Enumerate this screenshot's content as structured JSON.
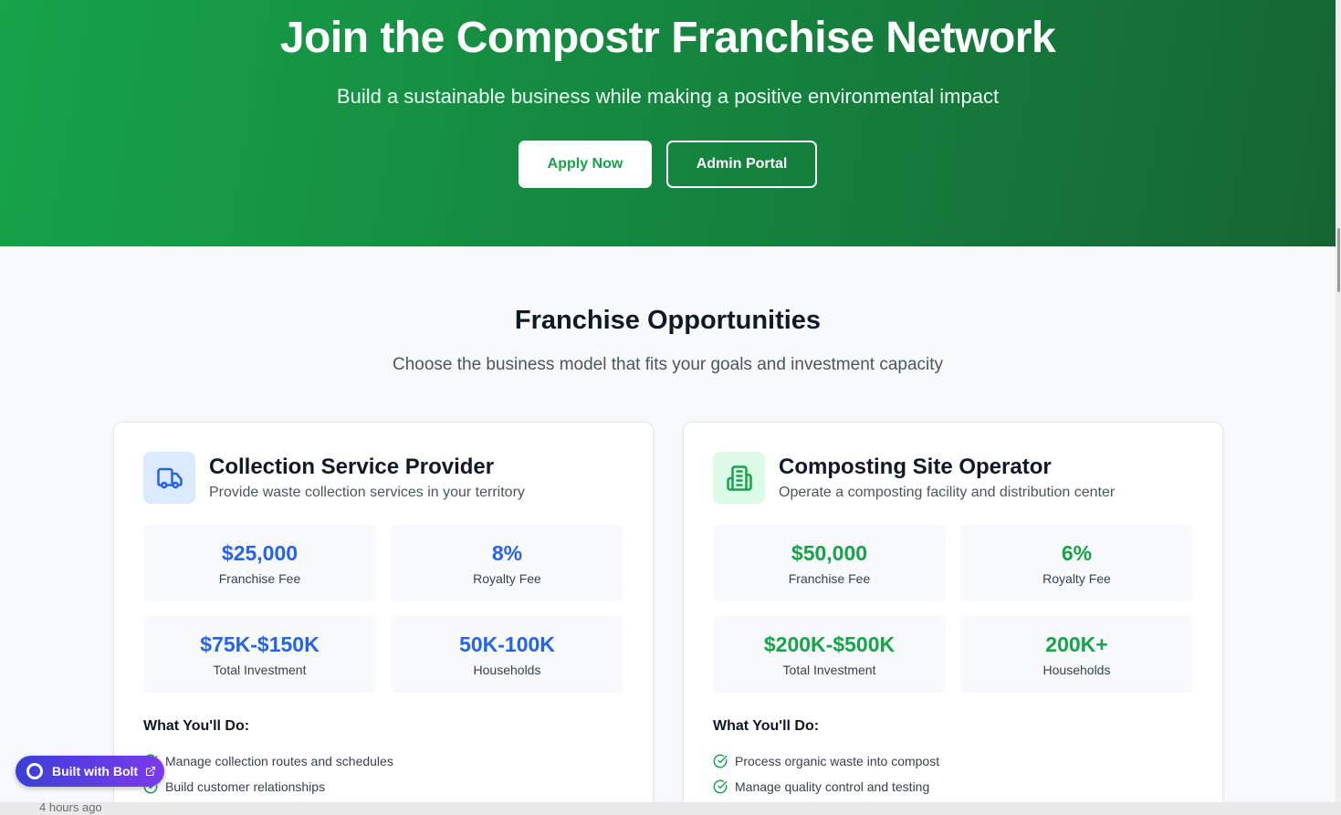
{
  "hero": {
    "title": "Join the Compostr Franchise Network",
    "subtitle": "Build a sustainable business while making a positive environmental impact",
    "apply_label": "Apply Now",
    "admin_label": "Admin Portal"
  },
  "opportunities": {
    "title": "Franchise Opportunities",
    "subtitle": "Choose the business model that fits your goals and investment capacity"
  },
  "cards": [
    {
      "icon": "truck-icon",
      "accent": "#2563eb",
      "title": "Collection Service Provider",
      "description": "Provide waste collection services in your territory",
      "stats": [
        {
          "value": "$25,000",
          "label": "Franchise Fee"
        },
        {
          "value": "8%",
          "label": "Royalty Fee"
        },
        {
          "value": "$75K-$150K",
          "label": "Total Investment"
        },
        {
          "value": "50K-100K",
          "label": "Households"
        }
      ],
      "todo_title": "What You'll Do:",
      "todos": [
        "Manage collection routes and schedules",
        "Build customer relationships"
      ]
    },
    {
      "icon": "building-icon",
      "accent": "#16a34a",
      "title": "Composting Site Operator",
      "description": "Operate a composting facility and distribution center",
      "stats": [
        {
          "value": "$50,000",
          "label": "Franchise Fee"
        },
        {
          "value": "6%",
          "label": "Royalty Fee"
        },
        {
          "value": "$200K-$500K",
          "label": "Total Investment"
        },
        {
          "value": "200K+",
          "label": "Households"
        }
      ],
      "todo_title": "What You'll Do:",
      "todos": [
        "Process organic waste into compost",
        "Manage quality control and testing"
      ]
    }
  ],
  "badge": {
    "label": "Built with Bolt",
    "icon": "external-link-icon"
  },
  "underlay": {
    "text": "4 hours ago"
  },
  "colors": {
    "hero_start": "#16a34a",
    "hero_end": "#166534",
    "blue": "#2563eb",
    "green": "#16a34a",
    "bolt": "#4f46e5"
  }
}
